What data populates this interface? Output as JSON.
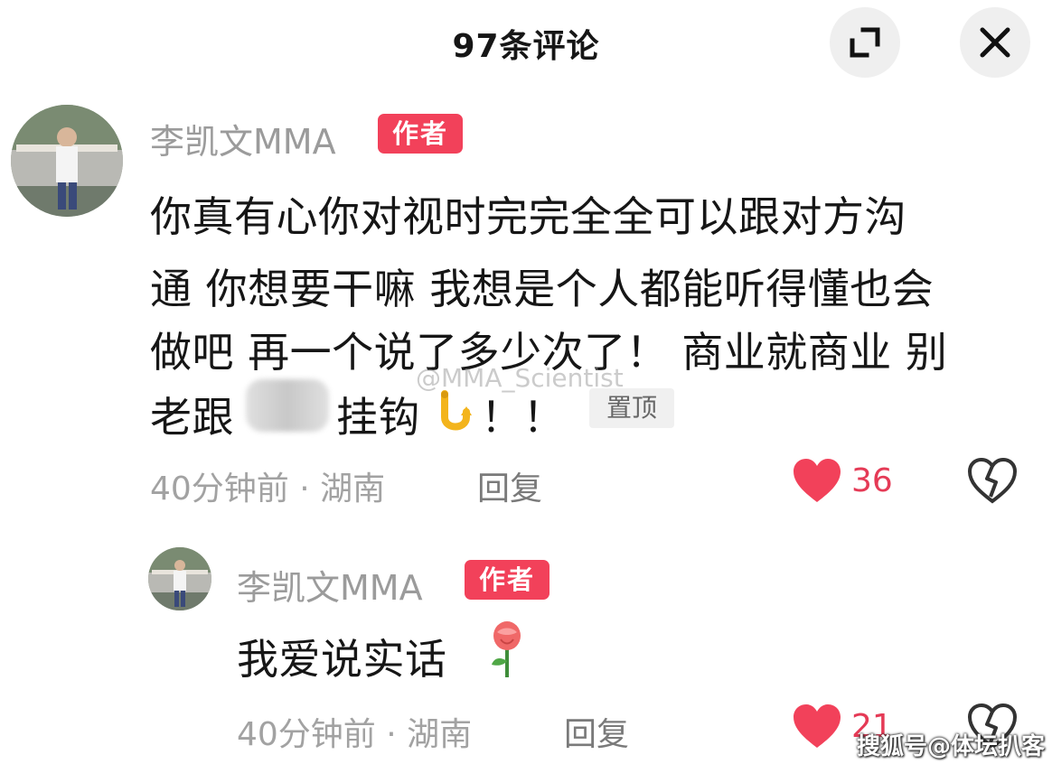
{
  "header": {
    "title": "97条评论"
  },
  "comment": {
    "username": "李凯文MMA",
    "badge": "作者",
    "lines": [
      "你真有心你对视时完完全全可以跟对方沟",
      "通 你想要干嘛 我想是个人都能听得懂也会",
      "做吧 再一个说了多少次了！ 商业就商业 别",
      "老跟",
      "挂钩",
      "！！"
    ],
    "pinned": "置顶",
    "watermark": "@MMA_Scientist",
    "time": "40分钟前 · 湖南",
    "reply": "回复",
    "likes": "36"
  },
  "reply_comment": {
    "username": "李凯文MMA",
    "badge": "作者",
    "text": "我爱说实话",
    "time": "40分钟前 · 湖南",
    "reply": "回复",
    "likes": "21"
  },
  "footer": {
    "watermark": "搜狐号@体坛扒客"
  },
  "colors": {
    "accent": "#f2415a",
    "like": "#e53a56",
    "muted": "#9b9b9b"
  },
  "icons": [
    "expand-icon",
    "close-icon",
    "heart-icon",
    "dislike-icon",
    "hook-emoji",
    "rose-emoji"
  ]
}
